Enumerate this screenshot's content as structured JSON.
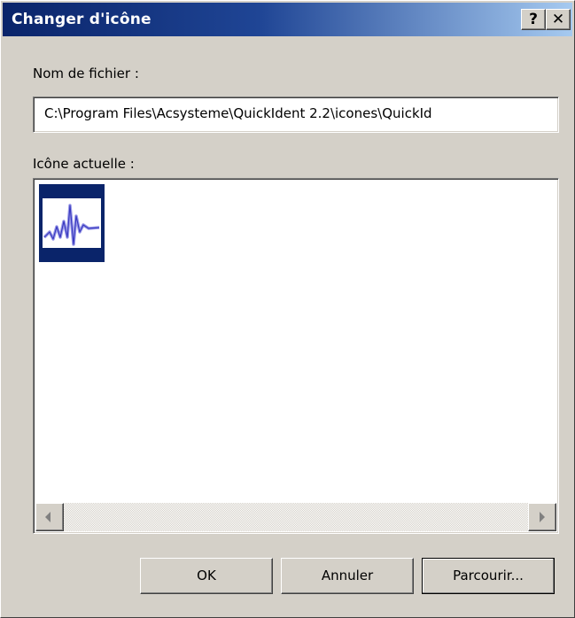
{
  "window": {
    "title": "Changer d'icône",
    "help_label": "?",
    "close_label": "✕"
  },
  "filename": {
    "label": "Nom de fichier :",
    "value": "C:\\Program Files\\Acsysteme\\QuickIdent 2.2\\icones\\QuickId"
  },
  "current_icon": {
    "label": "Icône actuelle :",
    "icons": [
      {
        "name": "quickident-waveform-icon",
        "selected": true
      }
    ]
  },
  "buttons": {
    "ok": "OK",
    "cancel": "Annuler",
    "browse": "Parcourir..."
  },
  "colors": {
    "title_bar_start": "#0a246a",
    "title_bar_end": "#a6caf0",
    "dialog_face": "#d4d0c8",
    "selection": "#0a246a"
  }
}
